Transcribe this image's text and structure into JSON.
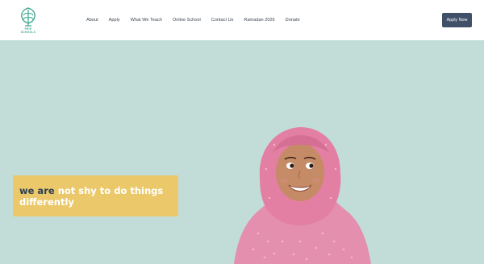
{
  "logo": {
    "text": "FRIE SCHOOLS"
  },
  "nav": {
    "items": [
      {
        "label": "About"
      },
      {
        "label": "Apply"
      },
      {
        "label": "What We Teach"
      },
      {
        "label": "Online School"
      },
      {
        "label": "Contact Us"
      },
      {
        "label": "Ramadan 2026"
      },
      {
        "label": "Donate"
      }
    ]
  },
  "cta": {
    "label": "Apply Now"
  },
  "hero": {
    "headline_dark": "we are",
    "headline_light": "not shy to do things differently"
  },
  "colors": {
    "accent": "#3f5068",
    "hero_bg": "#c2ddd8",
    "headline_box": "#ebc96a",
    "logo_green": "#3aa58c"
  },
  "icons": {
    "logo": "tree-leaf-logo-icon"
  }
}
